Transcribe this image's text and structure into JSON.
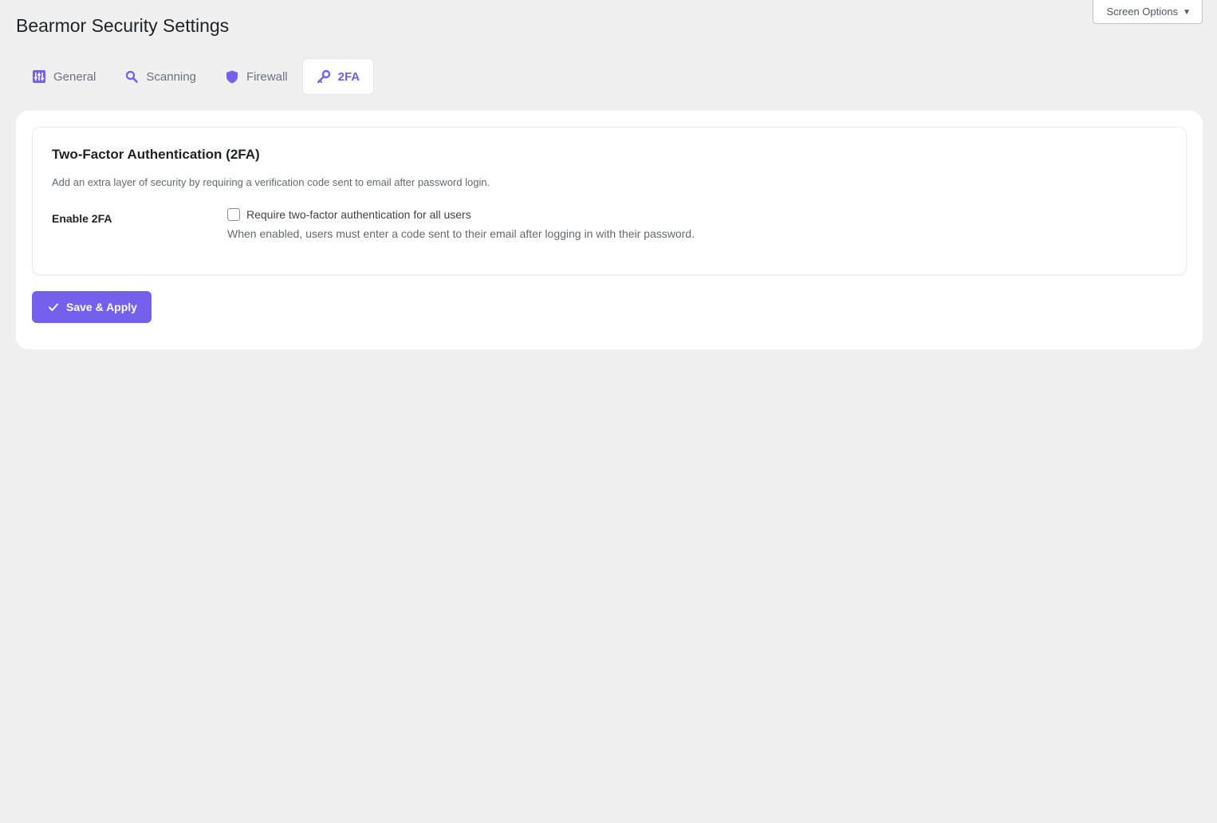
{
  "page": {
    "title": "Bearmor Security Settings"
  },
  "screen_options": {
    "label": "Screen Options",
    "caret_icon": "caret-down-icon"
  },
  "tabs": [
    {
      "label": "General",
      "icon": "sliders-icon",
      "active": false
    },
    {
      "label": "Scanning",
      "icon": "search-icon",
      "active": false
    },
    {
      "label": "Firewall",
      "icon": "shield-icon",
      "active": false
    },
    {
      "label": "2FA",
      "icon": "key-icon",
      "active": true
    }
  ],
  "section": {
    "title": "Two-Factor Authentication (2FA)",
    "description": "Add an extra layer of security by requiring a verification code sent to email after password login.",
    "field": {
      "label": "Enable 2FA",
      "checkbox_label": "Require two-factor authentication for all users",
      "checked": false,
      "help": "When enabled, users must enter a code sent to their email after logging in with their password."
    }
  },
  "save_button": {
    "label": "Save & Apply",
    "icon": "checkmark-icon"
  },
  "colors": {
    "accent": "#7460ee",
    "tab_active_text": "#6c5ce7",
    "tab_inactive_text": "#6b7280",
    "background": "#f0f0f1",
    "card": "#ffffff"
  }
}
